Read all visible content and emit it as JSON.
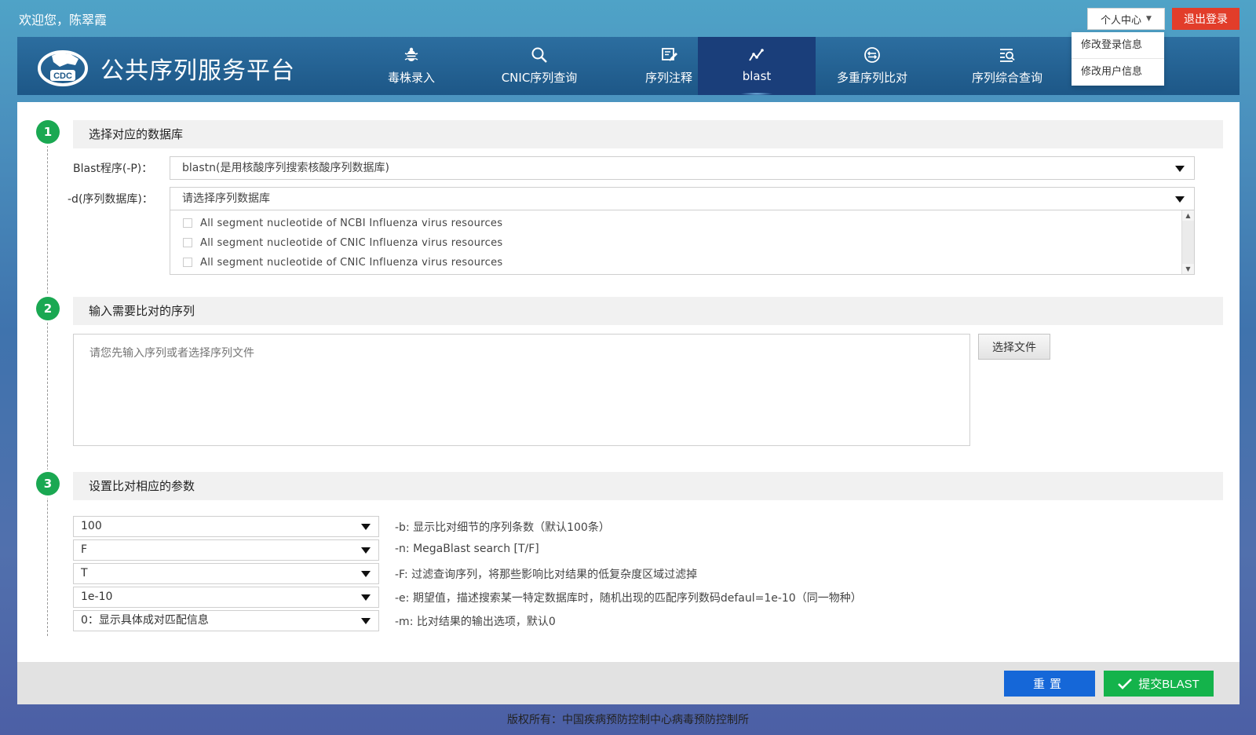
{
  "top": {
    "welcome": "欢迎您，陈翠霞",
    "user_menu_label": "个人中心",
    "logout_label": "退出登录",
    "dropdown_items": [
      "修改登录信息",
      "修改用户信息"
    ]
  },
  "header": {
    "logo_text": "CDC",
    "title": "公共序列服务平台",
    "nav": [
      {
        "label": "毒株录入",
        "icon": "bug-icon"
      },
      {
        "label": "CNIC序列查询",
        "icon": "search-icon"
      },
      {
        "label": "序列注释",
        "icon": "edit-icon"
      },
      {
        "label": "blast",
        "icon": "line-chart-icon",
        "active": true
      },
      {
        "label": "多重序列比对",
        "icon": "compare-icon"
      },
      {
        "label": "序列综合查询",
        "icon": "list-search-icon"
      }
    ]
  },
  "step1": {
    "number": "1",
    "title": "选择对应的数据库",
    "program_label": "Blast程序(-P)：",
    "program_value": "blastn(是用核酸序列搜索核酸序列数据库)",
    "db_label": "-d(序列数据库)：",
    "db_placeholder": "请选择序列数据库",
    "db_options": [
      "All segment nucleotide of NCBI Influenza virus resources",
      "All segment nucleotide of CNIC Influenza virus resources",
      "All segment nucleotide of CNIC Influenza virus resources"
    ]
  },
  "step2": {
    "number": "2",
    "title": "输入需要比对的序列",
    "placeholder": "请您先输入序列或者选择序列文件",
    "file_button": "选择文件"
  },
  "step3": {
    "number": "3",
    "title": "设置比对相应的参数",
    "params": [
      {
        "value": "100",
        "desc": "-b: 显示比对细节的序列条数（默认100条）"
      },
      {
        "value": "F",
        "desc": "-n: MegaBlast search [T/F]"
      },
      {
        "value": "T",
        "desc": "-F: 过滤查询序列，将那些影响比对结果的低复杂度区域过滤掉"
      },
      {
        "value": "1e-10",
        "desc": "-e: 期望值，描述搜索某一特定数据库时，随机出现的匹配序列数码defaul=1e-10（同一物种）"
      },
      {
        "value": "0：显示具体成对匹配信息",
        "desc": "-m: 比对结果的输出选项，默认0"
      }
    ]
  },
  "actions": {
    "reset": "重置",
    "submit": "提交BLAST"
  },
  "footer": {
    "copyright": "版权所有：中国疾病预防控制中心病毒预防控制所"
  },
  "colors": {
    "header": "#1d5787",
    "nav_active": "#1a3e7a",
    "step_green": "#1aa852",
    "reset_blue": "#1567d8",
    "submit_green": "#14b34b",
    "logout_red": "#e23d2a"
  }
}
